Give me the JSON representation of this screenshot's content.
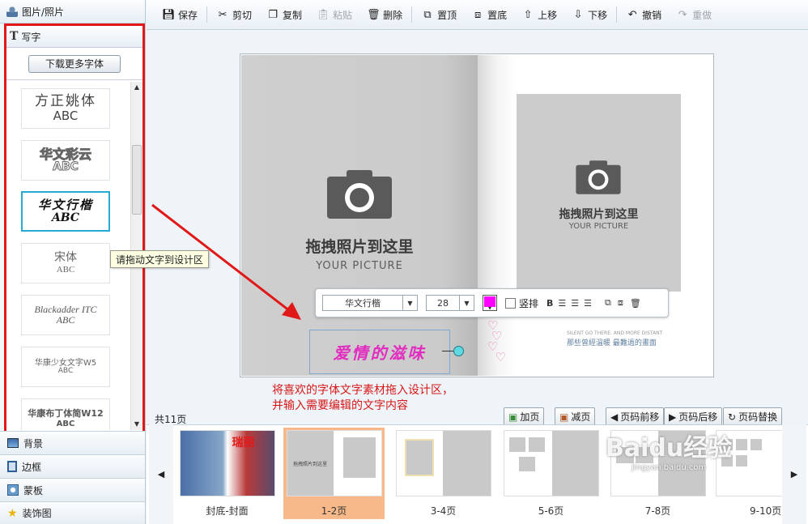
{
  "sidebar": {
    "top_item": "图片/照片",
    "write_header": "写字",
    "download_button": "下载更多字体",
    "fonts": [
      {
        "name": "方正姚体",
        "sample": "ABC"
      },
      {
        "name": "华文彩云",
        "sample": "ABC"
      },
      {
        "name": "华文行楷",
        "sample": "ABC"
      },
      {
        "name": "宋体",
        "sample": "ABC"
      },
      {
        "name": "Blackadder ITC",
        "sample": "ABC"
      },
      {
        "name": "华康少女文字W5",
        "sample": "ABC"
      },
      {
        "name": "华康布丁体简W12",
        "sample": "ABC"
      }
    ],
    "selected_font_index": 2,
    "bottom_items": [
      "背景",
      "边框",
      "蒙板",
      "装饰图"
    ]
  },
  "tooltip": "请拖动文字到设计区",
  "toolbar": {
    "buttons": [
      {
        "label": "保存",
        "icon": "save-icon",
        "enabled": true
      },
      {
        "label": "剪切",
        "icon": "scissors-icon",
        "enabled": true
      },
      {
        "label": "复制",
        "icon": "copy-icon",
        "enabled": true
      },
      {
        "label": "粘贴",
        "icon": "paste-icon",
        "enabled": false
      },
      {
        "label": "删除",
        "icon": "trash-icon",
        "enabled": true
      },
      {
        "label": "置顶",
        "icon": "bring-front-icon",
        "enabled": true
      },
      {
        "label": "置底",
        "icon": "send-back-icon",
        "enabled": true
      },
      {
        "label": "上移",
        "icon": "move-up-icon",
        "enabled": true
      },
      {
        "label": "下移",
        "icon": "move-down-icon",
        "enabled": true
      },
      {
        "label": "撤销",
        "icon": "undo-icon",
        "enabled": true
      },
      {
        "label": "重做",
        "icon": "redo-icon",
        "enabled": false
      }
    ]
  },
  "canvas": {
    "left_placeholder": {
      "title": "拖拽照片到这里",
      "sub": "YOUR PICTURE"
    },
    "right_placeholder": {
      "title": "拖拽照片到这里",
      "sub": "YOUR PICTURE"
    },
    "deco_text_1": "那些曾經溫暖 最難過的畫面",
    "deco_text_2": "SILENT GO THERE. AND MORE DISTANT",
    "text_element": "爱情的滋味"
  },
  "text_toolbar": {
    "font": "华文行楷",
    "size": "28",
    "color": "#ff00ff",
    "vertical_label": "竖排",
    "bold_label": "B"
  },
  "instruction": {
    "line1": "将喜欢的字体文字素材拖入设计区，",
    "line2": "并输入需要编辑的文字内容"
  },
  "page_count": "共11页",
  "page_buttons": [
    "加页",
    "减页",
    "页码前移",
    "页码后移",
    "页码替换"
  ],
  "thumbnails": [
    {
      "label": "封底-封面",
      "selected": false
    },
    {
      "label": "1-2页",
      "selected": true
    },
    {
      "label": "3-4页",
      "selected": false
    },
    {
      "label": "5-6页",
      "selected": false
    },
    {
      "label": "7-8页",
      "selected": false
    },
    {
      "label": "9-10页",
      "selected": false
    }
  ],
  "thumb_texts": {
    "cover_title": "瑞丽",
    "mini_ph": "拖拽照片到这里"
  },
  "watermark": {
    "main": "Baidu经验",
    "sub": "jingyan.baidu.com"
  },
  "colors": {
    "highlight": "#e01818",
    "selection": "#27a9d8",
    "selected_thumb": "#f7b98a"
  }
}
